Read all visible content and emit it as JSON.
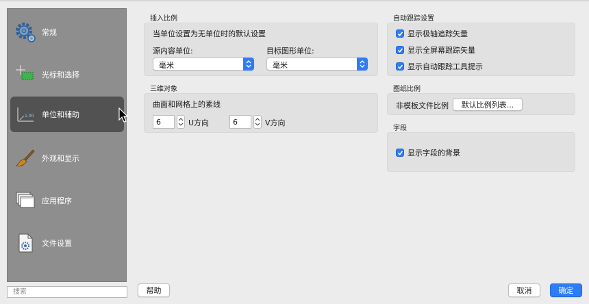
{
  "sidebar": {
    "items": [
      {
        "label": "常规",
        "icon": "gear-icon"
      },
      {
        "label": "光标和选择",
        "icon": "crosshair-selection-icon"
      },
      {
        "label": "单位和辅助",
        "icon": "units-ruler-icon",
        "selected": true
      },
      {
        "label": "外观和显示",
        "icon": "paintbrush-icon"
      },
      {
        "label": "应用程序",
        "icon": "application-windows-icon"
      },
      {
        "label": "文件设置",
        "icon": "file-settings-icon"
      }
    ]
  },
  "search": {
    "placeholder": "搜索"
  },
  "footer": {
    "help_label": "帮助",
    "cancel_label": "取消",
    "ok_label": "确定"
  },
  "insertion_scale": {
    "title": "插入比例",
    "description": "当单位设置为无单位时的默认设置",
    "source_label": "源内容单位:",
    "source_value": "毫米",
    "target_label": "目标图形单位:",
    "target_value": "毫米"
  },
  "three_d": {
    "title": "三维对象",
    "description": "曲面和网格上的素线",
    "u_value": "6",
    "u_label": "U方向",
    "v_value": "6",
    "v_label": "V方向"
  },
  "autotrack": {
    "title": "自动跟踪设置",
    "options": [
      {
        "label": "显示极轴追踪矢量",
        "checked": true
      },
      {
        "label": "显示全屏幕跟踪矢量",
        "checked": true
      },
      {
        "label": "显示自动跟踪工具提示",
        "checked": true
      }
    ]
  },
  "paper_scale": {
    "title": "图纸比例",
    "label": "非模板文件比例",
    "button_label": "默认比例列表..."
  },
  "fields": {
    "title": "字段",
    "option_label": "显示字段的背景",
    "checked": true
  },
  "colors": {
    "accent": "#2e7cf6",
    "sidebar_bg": "#8e8e8e",
    "sidebar_selected": "#525252"
  }
}
